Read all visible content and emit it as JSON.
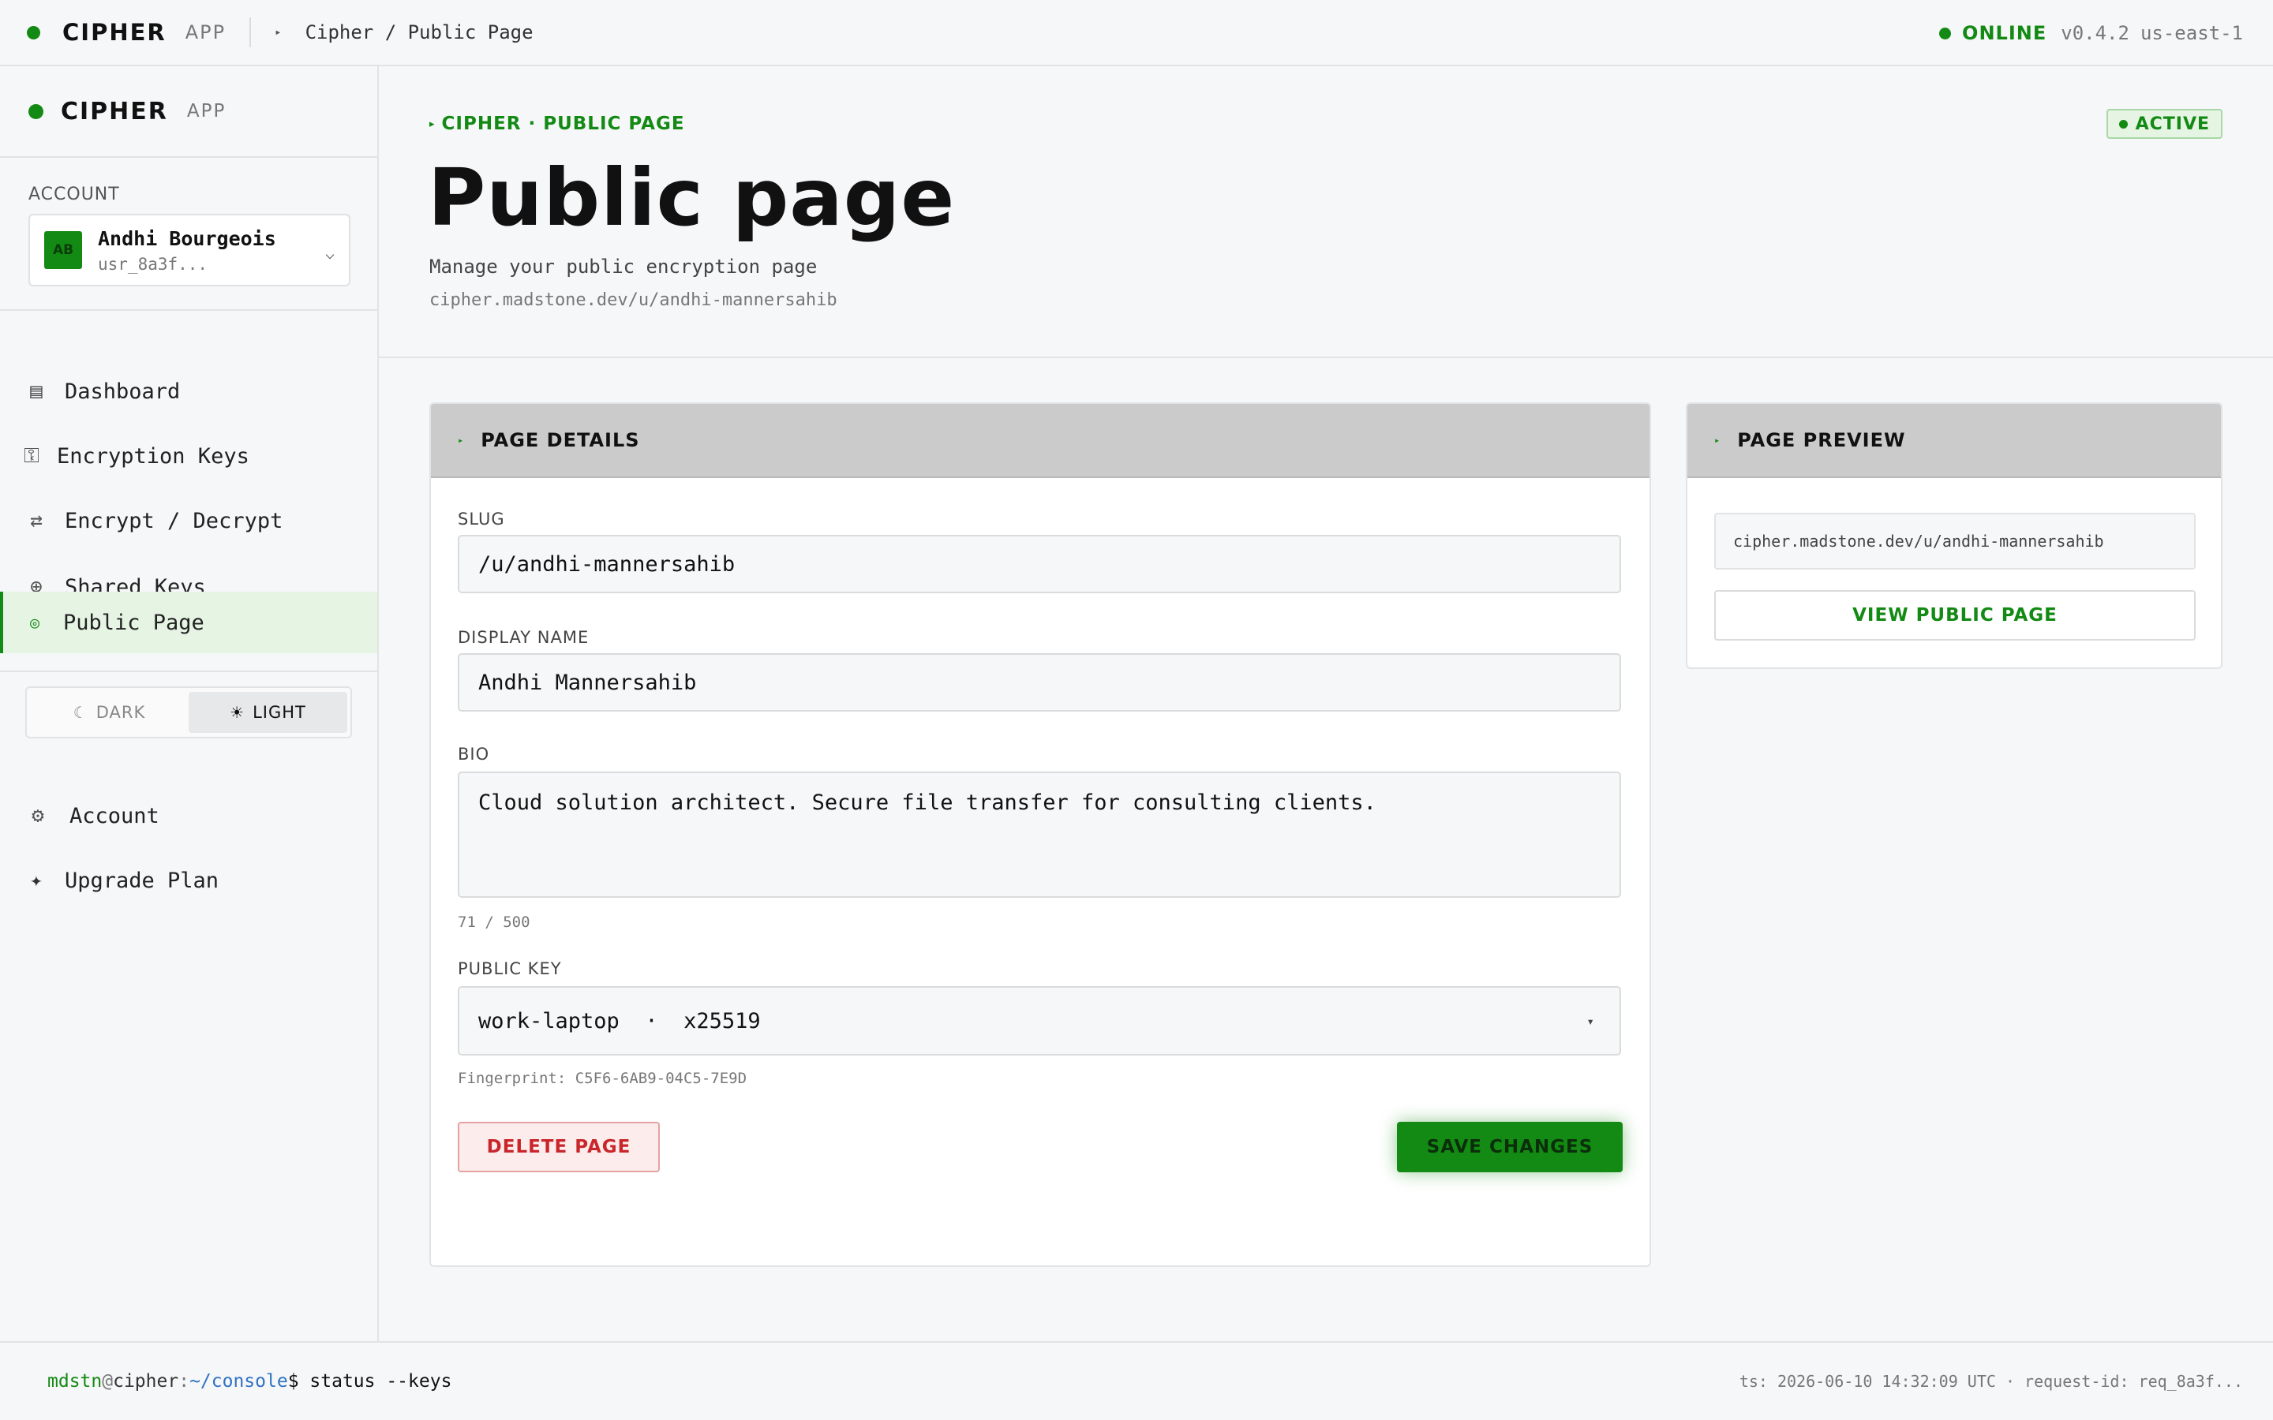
{
  "topbar": {
    "brand": "CIPHER",
    "brand_sub": "APP",
    "breadcrumb": "Cipher / Public Page",
    "status": "ONLINE",
    "version": "v0.4.2",
    "region": "us-east-1"
  },
  "sidebar": {
    "brand": "CIPHER",
    "brand_sub": "APP",
    "account_label": "ACCOUNT",
    "account": {
      "initials": "AB",
      "name": "Andhi Bourgeois",
      "id": "usr_8a3f..."
    },
    "nav": [
      {
        "label": "Dashboard",
        "icon": "grid-icon"
      },
      {
        "label": "Encryption Keys",
        "icon": "key-icon"
      },
      {
        "label": "Encrypt / Decrypt",
        "icon": "swap-arrows-icon"
      },
      {
        "label": "Shared Keys",
        "icon": "globe-icon"
      },
      {
        "label": "Public Page",
        "icon": "target-icon",
        "active": true
      }
    ],
    "theme": {
      "dark_label": "DARK",
      "light_label": "LIGHT",
      "selected": "LIGHT"
    },
    "bottom_nav": [
      {
        "label": "Account",
        "icon": "gear-icon"
      },
      {
        "label": "Upgrade Plan",
        "icon": "sparkle-icon"
      }
    ]
  },
  "page": {
    "eyebrow": "CIPHER · PUBLIC PAGE",
    "title": "Public page",
    "subtitle": "Manage your public encryption page",
    "url": "cipher.madstone.dev/u/andhi-mannersahib",
    "status": "ACTIVE"
  },
  "details": {
    "title": "PAGE DETAILS",
    "slug_label": "SLUG",
    "slug_value": "/u/andhi-mannersahib",
    "display_name_label": "DISPLAY NAME",
    "display_name_value": "Andhi Mannersahib",
    "bio_label": "BIO",
    "bio_value": "Cloud solution architect. Secure file transfer for consulting clients.",
    "bio_count": "71 / 500",
    "public_key_label": "PUBLIC KEY",
    "public_key_value": "work-laptop  ·  x25519",
    "fingerprint": "Fingerprint: C5F6-6AB9-04C5-7E9D",
    "delete_label": "DELETE PAGE",
    "save_label": "SAVE CHANGES"
  },
  "preview": {
    "title": "PAGE PREVIEW",
    "url": "cipher.madstone.dev/u/andhi-mannersahib",
    "view_label": "VIEW PUBLIC PAGE"
  },
  "footer": {
    "user": "mdstn",
    "at": "@",
    "host": "cipher",
    "colon": ":",
    "path": "~/console",
    "dollar": "$",
    "command": "status --keys",
    "meta": "ts: 2026-06-10 14:32:09 UTC · request-id: req_8a3f..."
  },
  "colors": {
    "accent": "#138a13",
    "danger": "#c9262b",
    "panel_header": "#cbcbcb",
    "background": "#f6f7f8"
  }
}
